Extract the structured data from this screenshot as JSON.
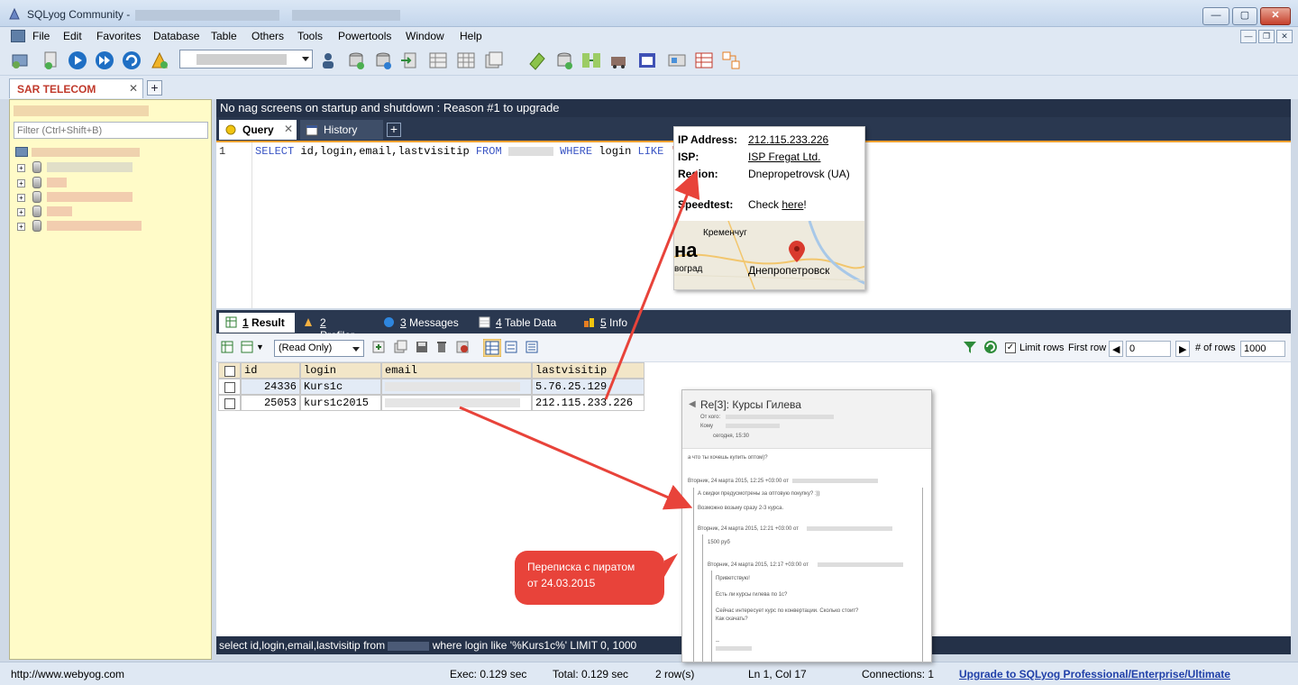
{
  "window": {
    "title": "SQLyog Community -"
  },
  "menu": [
    "File",
    "Edit",
    "Favorites",
    "Database",
    "Table",
    "Others",
    "Tools",
    "Powertools",
    "Window",
    "Help"
  ],
  "connection_tab": {
    "label": "SAR TELECOM",
    "close": "✕"
  },
  "object_browser": {
    "filter_placeholder": "Filter (Ctrl+Shift+B)"
  },
  "nag_text": "No nag screens on startup and shutdown : Reason #1 to upgrade",
  "query_tabs": {
    "query": "Query",
    "history": "History"
  },
  "editor": {
    "line": "1",
    "sql_pre": "SELECT",
    "sql_cols": " id,login,email,lastvisitip ",
    "sql_from": "FROM",
    "sql_where": "WHERE",
    "sql_login": " login ",
    "sql_like": "LIKE",
    "sql_tail": " '%"
  },
  "result_tabs": [
    {
      "num": "1",
      "label": " Result"
    },
    {
      "num": "2",
      "label": " Profiler"
    },
    {
      "num": "3",
      "label": " Messages"
    },
    {
      "num": "4",
      "label": " Table Data"
    },
    {
      "num": "5",
      "label": " Info"
    }
  ],
  "result_toolbar": {
    "mode": "(Read Only)",
    "limit_rows": "Limit rows",
    "first_row": "First row",
    "first_row_value": "0",
    "num_rows": "# of rows",
    "num_rows_value": "1000"
  },
  "grid": {
    "columns": [
      "id",
      "login",
      "email",
      "lastvisitip"
    ],
    "rows": [
      {
        "id": "24336",
        "login": "Kurs1c",
        "lastvisitip": "5.76.25.129"
      },
      {
        "id": "25053",
        "login": "kurs1c2015",
        "lastvisitip": "212.115.233.226"
      }
    ]
  },
  "query_bar": {
    "pre": "select id,login,email,lastvisitip from ",
    "post": " where login like '%Kurs1c%' LIMIT 0, 1000"
  },
  "status": {
    "url": "http://www.webyog.com",
    "exec": "Exec: 0.129 sec",
    "total": "Total: 0.129 sec",
    "rows": "2 row(s)",
    "position": "Ln 1, Col 17",
    "connections": "Connections: 1",
    "upgrade": "Upgrade to SQLyog Professional/Enterprise/Ultimate"
  },
  "ip_popup": {
    "ip_label": "IP Address:",
    "ip_value": "212.115.233.226",
    "isp_label": "ISP:",
    "isp_value": "ISP Fregat Ltd.",
    "region_label": "Region:",
    "region_value": "Dnepropetrovsk (UA)",
    "speed_label": "Speedtest:",
    "speed_pre": "Check ",
    "speed_link": "here",
    "speed_post": "!",
    "map_city1": "Кременчуг",
    "map_city2": "Днепропетровск",
    "map_big": "на",
    "map_city3": "воград"
  },
  "mail": {
    "subject": "Re[3]: Курсы Гилева",
    "from_label": "От кого:",
    "to_label": "Кому",
    "date_top": "сегодня, 15:30",
    "q1": "а что ты хочешь купить оптом)?",
    "h1": "Вторник, 24 марта 2015, 12:25 +03:00 от",
    "t1": "А скидки предусмотрены за оптовую покупку? :))",
    "t2": "Возможно возьму сразу 2-3 курса.",
    "h2": "Вторник, 24 марта 2015, 12:21 +03:00 от",
    "t3": "1500 руб",
    "h3": "Вторник, 24 марта 2015, 12:17 +03:00 от",
    "t4": "Приветствую!",
    "t5": "Есть ли курсы гилева по 1с?",
    "t6": "Сейчас интересует курс по конвертации. Сколько стоит?",
    "t7": "Как скачать?",
    "sig": "--"
  },
  "callout": {
    "line1": "Переписка с пиратом",
    "line2": "от 24.03.2015"
  },
  "colors": {
    "accent_red": "#e8433a",
    "nav_dark": "#243148",
    "browser_bg": "#fffbc8"
  }
}
